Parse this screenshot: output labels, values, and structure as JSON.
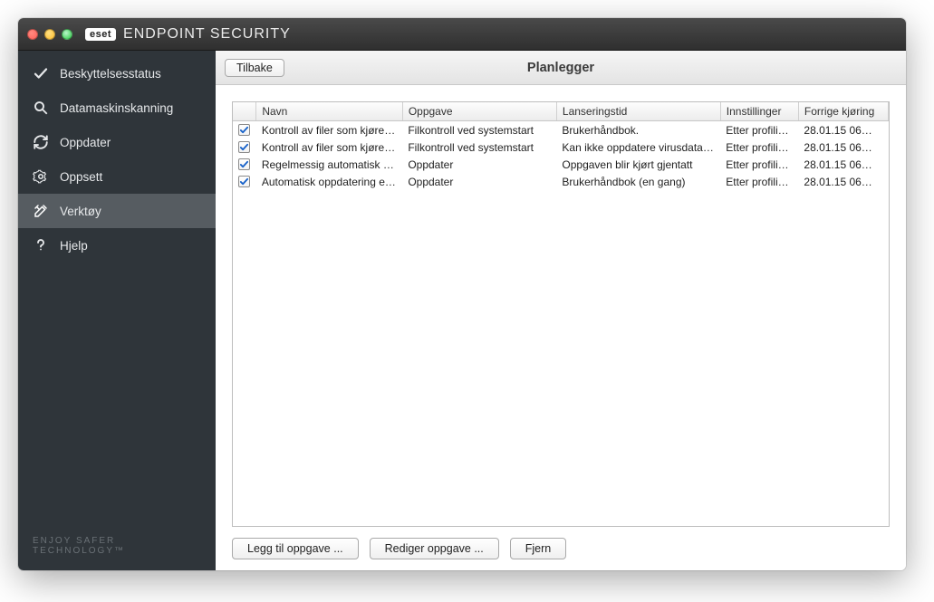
{
  "window": {
    "brand_logo": "eset",
    "brand_title": "ENDPOINT SECURITY"
  },
  "sidebar": {
    "items": [
      {
        "icon": "check-icon",
        "label": "Beskyttelsesstatus"
      },
      {
        "icon": "magnify-icon",
        "label": "Datamaskinskanning"
      },
      {
        "icon": "refresh-icon",
        "label": "Oppdater"
      },
      {
        "icon": "gear-icon",
        "label": "Oppsett"
      },
      {
        "icon": "tools-icon",
        "label": "Verktøy"
      },
      {
        "icon": "question-icon",
        "label": "Hjelp"
      }
    ],
    "active_index": 4,
    "footer": "ENJOY SAFER TECHNOLOGY™"
  },
  "toolbar": {
    "back_label": "Tilbake",
    "title": "Planlegger"
  },
  "table": {
    "headers": {
      "chk": "",
      "name": "Navn",
      "task": "Oppgave",
      "launch": "Lanseringstid",
      "settings": "Innstillinger",
      "last_run": "Forrige kjøring"
    },
    "rows": [
      {
        "checked": true,
        "name": "Kontroll av filer som kjøres ved oppstart",
        "task": "Filkontroll ved systemstart",
        "launch": "Brukerhåndbok.",
        "settings": "Etter profilinnlasting",
        "last_run": "28.01.15 06…"
      },
      {
        "checked": true,
        "name": "Kontroll av filer som kjøres ved oppstart",
        "task": "Filkontroll ved systemstart",
        "launch": "Kan ikke oppdatere virusdatabasen",
        "settings": "Etter profilinnlasting",
        "last_run": "28.01.15 06…"
      },
      {
        "checked": true,
        "name": "Regelmessig automatisk oppdatering",
        "task": "Oppdater",
        "launch": "Oppgaven blir kjørt gjentatt",
        "settings": "Etter profilinnlasting",
        "last_run": "28.01.15 06…"
      },
      {
        "checked": true,
        "name": "Automatisk oppdatering etter brukerpålogging",
        "task": "Oppdater",
        "launch": "Brukerhåndbok (en gang)",
        "settings": "Etter profilinnlasting",
        "last_run": "28.01.15 06…"
      }
    ]
  },
  "buttons": {
    "add": "Legg til oppgave ...",
    "edit": "Rediger oppgave ...",
    "remove": "Fjern"
  }
}
